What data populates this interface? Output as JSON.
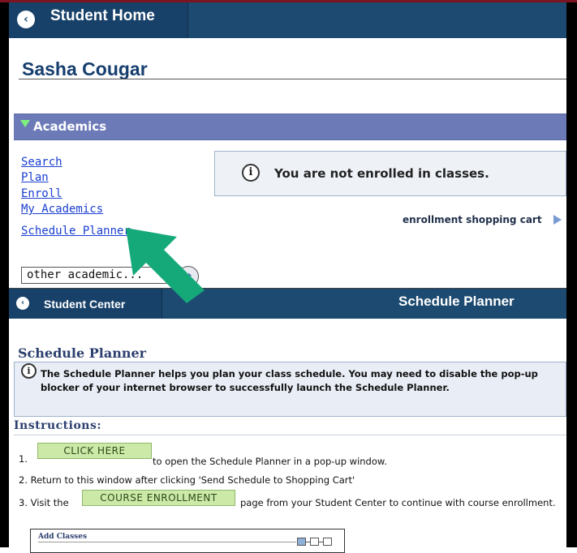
{
  "student_home": {
    "header": {
      "back_label": "Student Home"
    },
    "student_name": "Sasha Cougar",
    "academics": {
      "title": "Academics",
      "links": [
        "Search",
        "Plan",
        "Enroll",
        "My Academics"
      ],
      "schedule_planner_link": "Schedule Planner",
      "notice": "You are not enrolled in classes.",
      "cart_link": "enrollment shopping cart",
      "other_select_value": "other academic..."
    }
  },
  "schedule_planner": {
    "header": {
      "back_label": "Student Center",
      "title": "Schedule Planner"
    },
    "heading": "Schedule Planner",
    "info_text": "The Schedule Planner helps you plan your class schedule.  You may need to disable the pop-up blocker of your internet browser to successfully launch the Schedule Planner.",
    "instructions_heading": "Instructions:",
    "steps": {
      "s1_num": "1.",
      "s1_button": "CLICK HERE",
      "s1_text": "to open the Schedule Planner in a pop-up window.",
      "s2_text": "2. Return to this window after clicking   'Send Schedule to Shopping Cart'",
      "s3_prefix": "3. Visit the",
      "s3_button": "COURSE ENROLLMENT",
      "s3_text": "page from your Student Center to continue with course enrollment."
    },
    "add_classes": {
      "label": "Add Classes",
      "step1": "1",
      "step2": "2",
      "step3": "3"
    }
  },
  "colors": {
    "header_blue": "#1d4a70",
    "academics_bar": "#6c7bb8",
    "link_blue": "#1a3fd0",
    "arrow_green": "#15a97a",
    "button_green": "#cde9a8"
  }
}
